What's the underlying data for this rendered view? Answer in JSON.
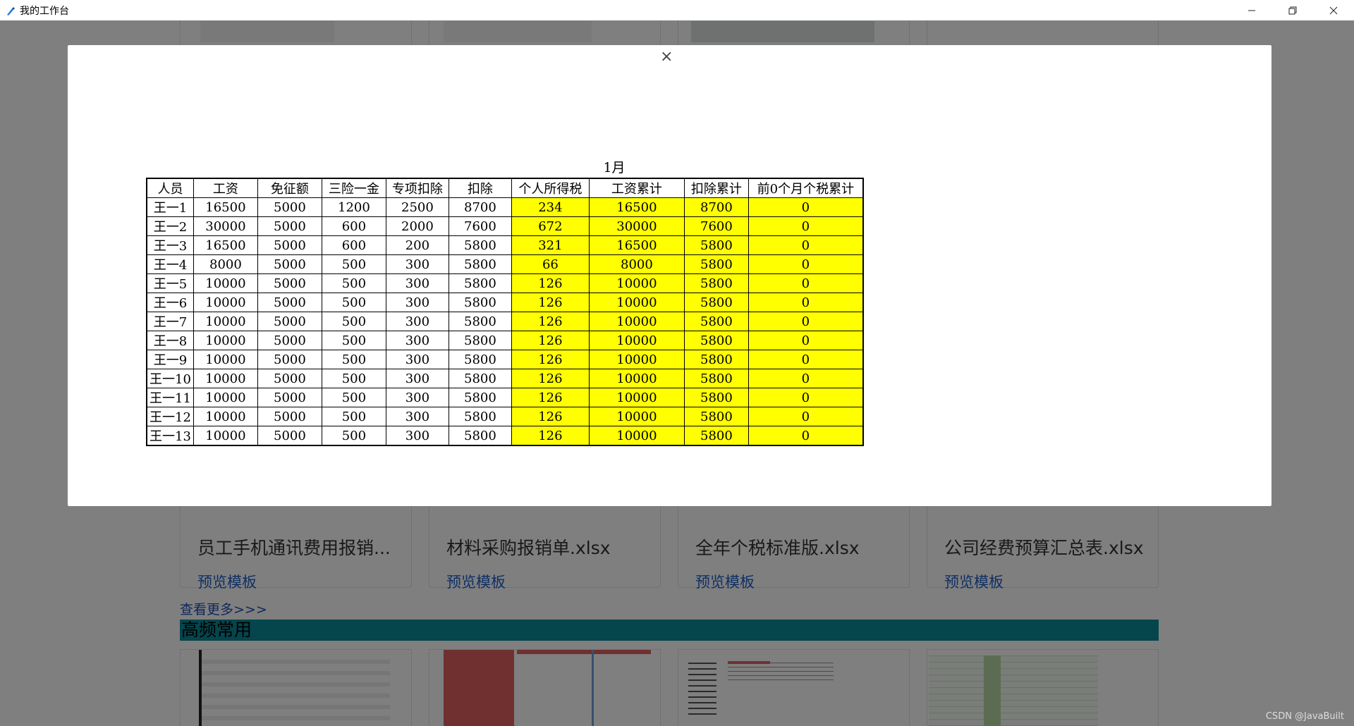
{
  "window": {
    "title": "我的工作台",
    "controls": [
      "minimize",
      "restore",
      "close"
    ]
  },
  "cards_row": [
    {
      "title": "员工手机通讯费用报销...",
      "link": "预览模板"
    },
    {
      "title": "材料采购报销单.xlsx",
      "link": "预览模板"
    },
    {
      "title": "全年个税标准版.xlsx",
      "link": "预览模板"
    },
    {
      "title": "公司经费预算汇总表.xlsx",
      "link": "预览模板"
    }
  ],
  "more_link": "查看更多>>>",
  "section_title": "高频常用",
  "modal": {
    "close_symbol": "×",
    "sheet_title": "1月",
    "headers": [
      "人员",
      "工资",
      "免征额",
      "三险一金",
      "专项扣除",
      "扣除",
      "个人所得税",
      "工资累计",
      "扣除累计",
      "前0个月个税累计"
    ],
    "rows": [
      [
        "王一1",
        "16500",
        "5000",
        "1200",
        "2500",
        "8700",
        "234",
        "16500",
        "8700",
        "0"
      ],
      [
        "王一2",
        "30000",
        "5000",
        "600",
        "2000",
        "7600",
        "672",
        "30000",
        "7600",
        "0"
      ],
      [
        "王一3",
        "16500",
        "5000",
        "600",
        "200",
        "5800",
        "321",
        "16500",
        "5800",
        "0"
      ],
      [
        "王一4",
        "8000",
        "5000",
        "500",
        "300",
        "5800",
        "66",
        "8000",
        "5800",
        "0"
      ],
      [
        "王一5",
        "10000",
        "5000",
        "500",
        "300",
        "5800",
        "126",
        "10000",
        "5800",
        "0"
      ],
      [
        "王一6",
        "10000",
        "5000",
        "500",
        "300",
        "5800",
        "126",
        "10000",
        "5800",
        "0"
      ],
      [
        "王一7",
        "10000",
        "5000",
        "500",
        "300",
        "5800",
        "126",
        "10000",
        "5800",
        "0"
      ],
      [
        "王一8",
        "10000",
        "5000",
        "500",
        "300",
        "5800",
        "126",
        "10000",
        "5800",
        "0"
      ],
      [
        "王一9",
        "10000",
        "5000",
        "500",
        "300",
        "5800",
        "126",
        "10000",
        "5800",
        "0"
      ],
      [
        "王一10",
        "10000",
        "5000",
        "500",
        "300",
        "5800",
        "126",
        "10000",
        "5800",
        "0"
      ],
      [
        "王一11",
        "10000",
        "5000",
        "500",
        "300",
        "5800",
        "126",
        "10000",
        "5800",
        "0"
      ],
      [
        "王一12",
        "10000",
        "5000",
        "500",
        "300",
        "5800",
        "126",
        "10000",
        "5800",
        "0"
      ],
      [
        "王一13",
        "10000",
        "5000",
        "500",
        "300",
        "5800",
        "126",
        "10000",
        "5800",
        "0"
      ]
    ]
  },
  "watermark": "CSDN @JavaBuilt",
  "colors": {
    "highlight": "#ffff00",
    "section_bar": "#0a8b98",
    "link": "#1f5fc7"
  }
}
